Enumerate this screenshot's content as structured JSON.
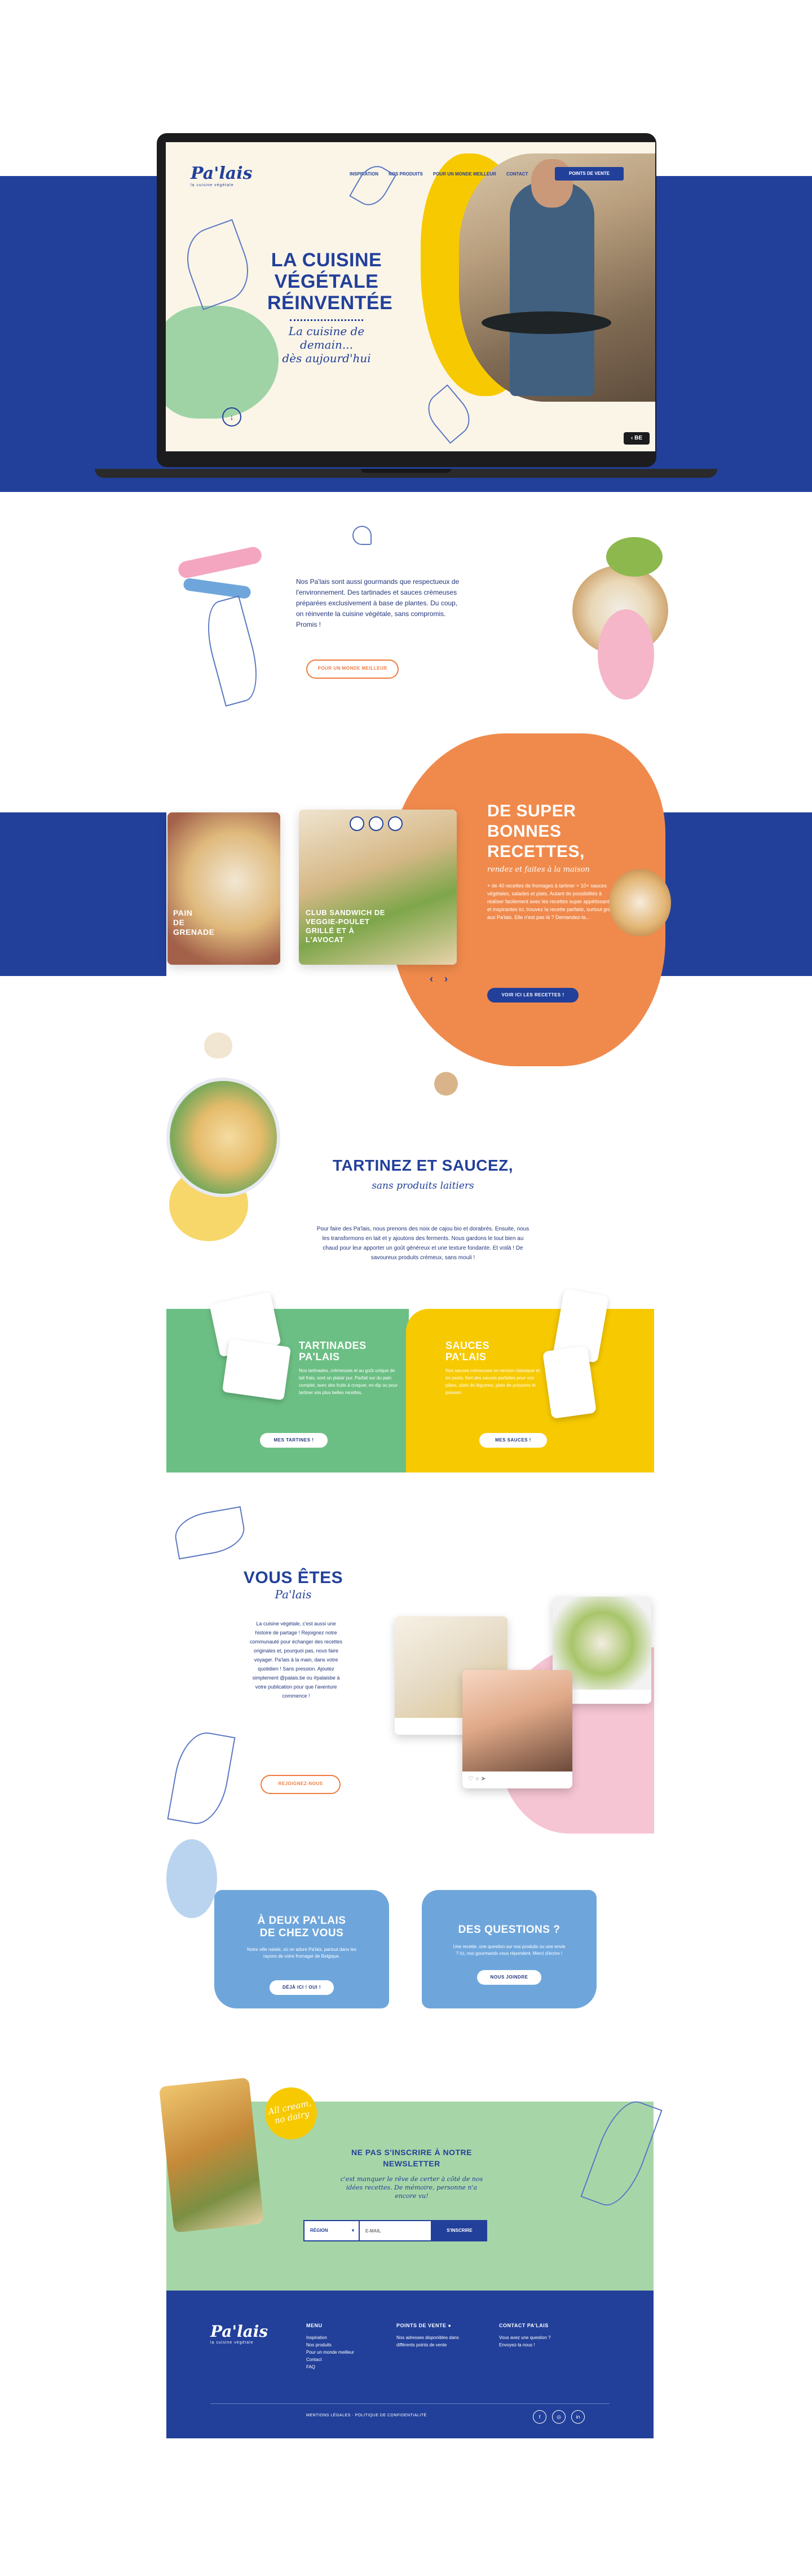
{
  "colors": {
    "navy": "#22409a",
    "orange": "#f07b3f",
    "green": "#6cbf84",
    "yellow": "#f7c900",
    "pink": "#f4b6c8",
    "blue": "#6ea6dc",
    "mint": "#a6d6a8",
    "cream": "#fbf5e8"
  },
  "hero": {
    "logo": "Pa'lais",
    "logo_sub": "la cuisine végétale",
    "nav": [
      "INSPIRATION",
      "NOS PRODUITS",
      "POUR UN MONDE MEILLEUR",
      "CONTACT"
    ],
    "cta": "POINTS DE VENTE",
    "title_lines": [
      "LA CUISINE",
      "VÉGÉTALE",
      "RÉINVENTÉE"
    ],
    "subtitle_lines": [
      "La cuisine de demain...",
      "dès aujourd'hui"
    ],
    "lang": "BE"
  },
  "intro": {
    "text": "Nos Pa'lais sont aussi gourmands que respectueux de l'environnement. Des tartinades et sauces crémeuses préparées exclusivement à base de plantes. Du coup, on réinvente la cuisine végétale, sans compromis. Promis !",
    "button": "POUR UN MONDE MEILLEUR"
  },
  "recipes": {
    "title_lines": [
      "DE SUPER",
      "BONNES",
      "RECETTES,"
    ],
    "subtitle": "rendez et faites à la maison",
    "text": "+ de 40 recettes de fromages à tartiner + 10+ sauces végétales, salades et plats. Autant de possibilités à réaliser facilement avec les recettes super appétissantes et inspirantes ici, trouvez la recette parfaite, surtout grâce aux Pa'lais. Elle n'est pas là ? Demandez-la...",
    "button": "VOIR ICI LES RECETTES !",
    "cards": [
      {
        "title_lines": [
          "PAIN",
          "DE",
          "GRENADE"
        ]
      },
      {
        "title_lines": [
          "CLUB SANDWICH DE",
          "VEGGIE-POULET",
          "GRILLÉ ET À",
          "L'AVOCAT"
        ]
      }
    ],
    "prev": "‹",
    "next": "›"
  },
  "spread": {
    "title": "TARTINEZ ET SAUCEZ,",
    "subtitle": "sans produits laitiers",
    "text": "Pour faire des Pa'lais, nous prenons des noix de cajou bio et dorabrés. Ensuite, nous les transformons en lait et y ajoutons des ferments. Nous gardons le tout bien au chaud pour leur apporter un goût généreux et une texture fondante. Et voilà ! De savoureux produits crémeux, sans mouli !"
  },
  "products": {
    "left": {
      "title_lines": [
        "TARTINADES",
        "PA'LAIS"
      ],
      "text": "Nos tartinades, crémeuses et au goût unique de lait frais, sont un plaisir pur. Parfait sur du pain complet, avec des fruits à croquer, en dip ou pour tartiner vos plus belles recettes.",
      "button": "MES TARTINES !"
    },
    "right": {
      "title_lines": [
        "SAUCES",
        "PA'LAIS"
      ],
      "text": "Nos sauces crémeuses en version classique et, en pesto, font des sauces parfaites pour vos pâtes, plats de légumes, plats de poissons et poisson.",
      "button": "MES SAUCES !"
    }
  },
  "community": {
    "title": "VOUS ÊTES",
    "subtitle": "Pa'lais",
    "text": "La cuisine végétale, c'est aussi une histoire de partage ! Rejoignez notre communauté pour échanger des recettes originales et, pourquoi pas, nous faire voyager. Pa'lais à la main, dans votre quotidien ! Sans pression. Ajoutez simplement @palais.be ou #palaisbe à votre publication pour que l'aventure commence !",
    "button": "REJOIGNEZ-NOUS"
  },
  "cards2": {
    "left": {
      "title_lines": [
        "À DEUX PA'LAIS",
        "DE CHEZ VOUS"
      ],
      "text": "Notre ville natale, où on adore Pa'lais, partout dans les rayons de votre fromager de Belgique.",
      "button": "DÉJÀ ICI ! OUI !"
    },
    "right": {
      "title": "DES QUESTIONS ?",
      "text": "Une recette, une question sur nos produits ou une envie ? Ici, nos gourmands vous répondent. Merci d'écrire !",
      "button": "NOUS JOINDRE"
    }
  },
  "newsletter": {
    "badge_lines": [
      "All cream,",
      "no dairy"
    ],
    "title_lines": [
      "NE PAS S'INSCRIRE À NOTRE",
      "NEWSLETTER"
    ],
    "subtitle_lines": [
      "c'est manquer le rêve de certer à côté de nos",
      "idées recettes. De mémoire, personne n'a",
      "encore vu!"
    ],
    "select_placeholder": "RÉGION",
    "email_placeholder": "E-MAIL",
    "submit": "S'INSCRIRE"
  },
  "footer": {
    "logo": "Pa'lais",
    "logo_sub": "la cuisine végétale",
    "menu_title": "MENU",
    "menu": [
      "Inspiration",
      "Nos produits",
      "Pour un monde meilleur",
      "Contact",
      "FAQ"
    ],
    "points_title": "POINTS DE VENTE",
    "points_text": "Nos adresses disponibles dans différents points de vente",
    "contact_title": "CONTACT PA'LAIS",
    "contact_text": "Vous avez une question ? Envoyez-la nous !",
    "legal": "MENTIONS LÉGALES · POLITIQUE DE CONFIDENTIALITÉ",
    "social": [
      "f",
      "◎",
      "in"
    ]
  }
}
